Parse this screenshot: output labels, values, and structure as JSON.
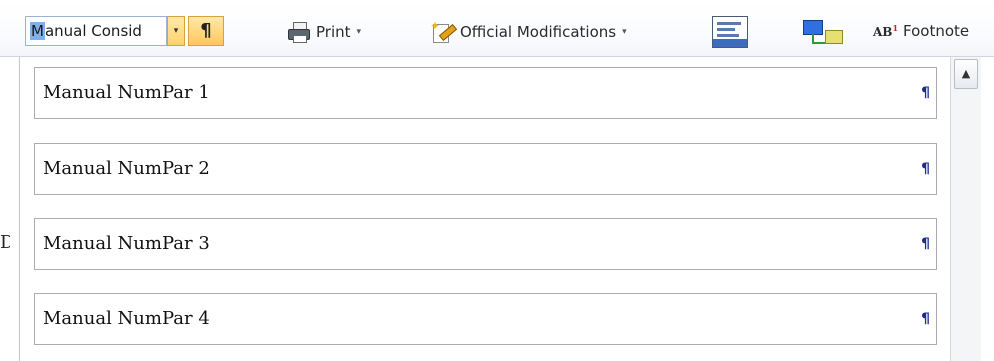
{
  "ribbon": {
    "style_box": {
      "value_highlighted": "M",
      "value_rest": "anual Consid"
    },
    "style_dropdown_arrow": "▾",
    "pilcrow_button": "¶",
    "print": {
      "label": "Print",
      "caret": "▾"
    },
    "official_modifications": {
      "label": "Official Modifications",
      "caret": "▾"
    },
    "footnote": {
      "ab_text": "AB",
      "ab_sup": "1",
      "label": "Footnote"
    }
  },
  "left_edge_glyph": "D",
  "gallery": {
    "items": [
      {
        "label": "Manual NumPar 1",
        "mark": "¶"
      },
      {
        "label": "Manual NumPar 2",
        "mark": "¶"
      },
      {
        "label": "Manual NumPar 3",
        "mark": "¶"
      },
      {
        "label": "Manual NumPar 4",
        "mark": "¶"
      }
    ],
    "scroll_up_glyph": "▲"
  },
  "colors": {
    "selection_highlight": "#7fb0e8",
    "pilcrow_blue": "#1f2a8c",
    "active_button_gold": "#ffd36b"
  }
}
